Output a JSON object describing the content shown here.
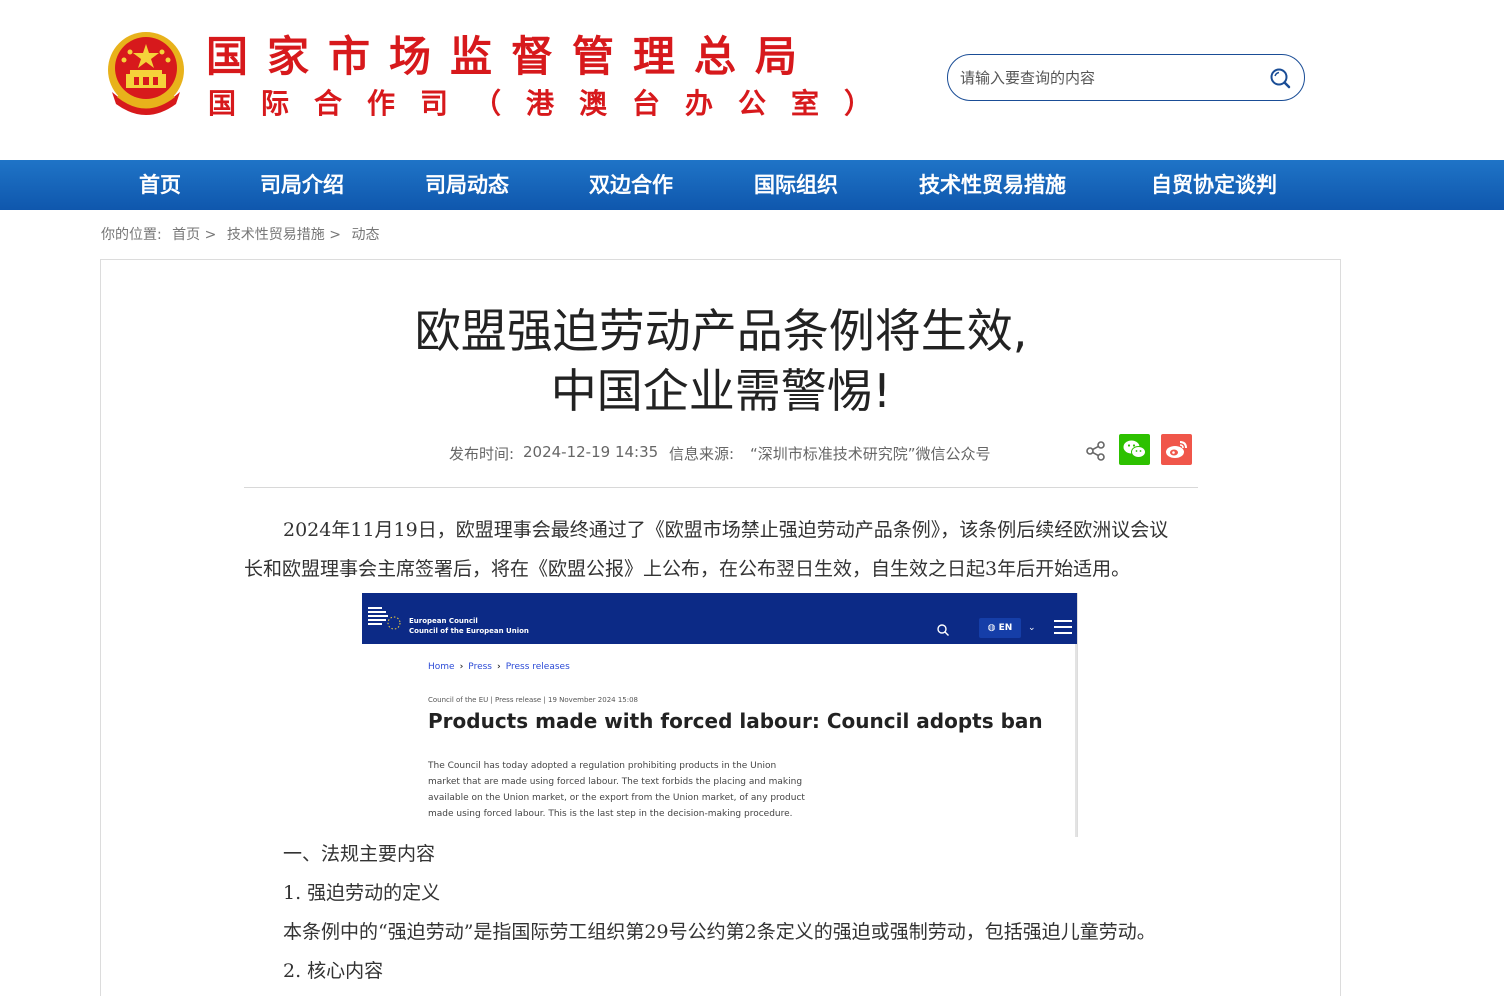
{
  "header": {
    "brand_line1": "国家市场监督管理总局",
    "brand_line2": "国际合作司（港澳台办公室）",
    "search_placeholder": "请输入要查询的内容",
    "colors": {
      "brand_red": "#d7191c",
      "nav_blue": "#1764bc",
      "search_border": "#1a4d96"
    }
  },
  "nav": {
    "items": [
      "首页",
      "司局介绍",
      "司局动态",
      "双边合作",
      "国际组织",
      "技术性贸易措施",
      "自贸协定谈判"
    ]
  },
  "breadcrumb": {
    "prefix": "你的位置:",
    "items": [
      "首页 >",
      "技术性贸易措施 >",
      "动态"
    ]
  },
  "article": {
    "title_line1": "欧盟强迫劳动产品条例将生效,",
    "title_line2": "中国企业需警惕!",
    "publish_label": "发布时间:",
    "publish_time": "2024-12-19 14:35",
    "source_label": "信息来源:",
    "source": "“深圳市标准技术研究院”微信公众号",
    "para1_line1": "2024年11月19日，欧盟理事会最终通过了《欧盟市场禁止强迫劳动产品条例》，该条例后续经欧洲议会议",
    "para1_line2": "长和欧盟理事会主席签署后，将在《欧盟公报》上公布，在公布翌日生效，自生效之日起3年后开始适用。",
    "section1": "一、法规主要内容",
    "sub1": "1. 强迫劳动的定义",
    "sub1_text": "本条例中的“强迫劳动”是指国际劳工组织第29号公约第2条定义的强迫或强制劳动，包括强迫儿童劳动。",
    "sub2": "2. 核心内容"
  },
  "embedded_screenshot": {
    "org_line1": "European Council",
    "org_line2": "Council of the European Union",
    "lang": "EN",
    "crumbs": [
      "Home",
      "Press",
      "Press releases"
    ],
    "meta": "Council of the EU |  Press release |  19 November 2024 15:08",
    "headline": "Products made with forced labour: Council adopts ban",
    "body_lines": [
      "The Council has today adopted a regulation prohibiting products in the Union",
      "market that are made using forced labour. The text forbids the placing and making",
      "available on the Union market, or the export from the Union market, of any product",
      "made using forced labour. This is the last step in the decision-making procedure."
    ],
    "colors": {
      "bar": "#0c2a86",
      "link": "#2c4bd6"
    }
  }
}
